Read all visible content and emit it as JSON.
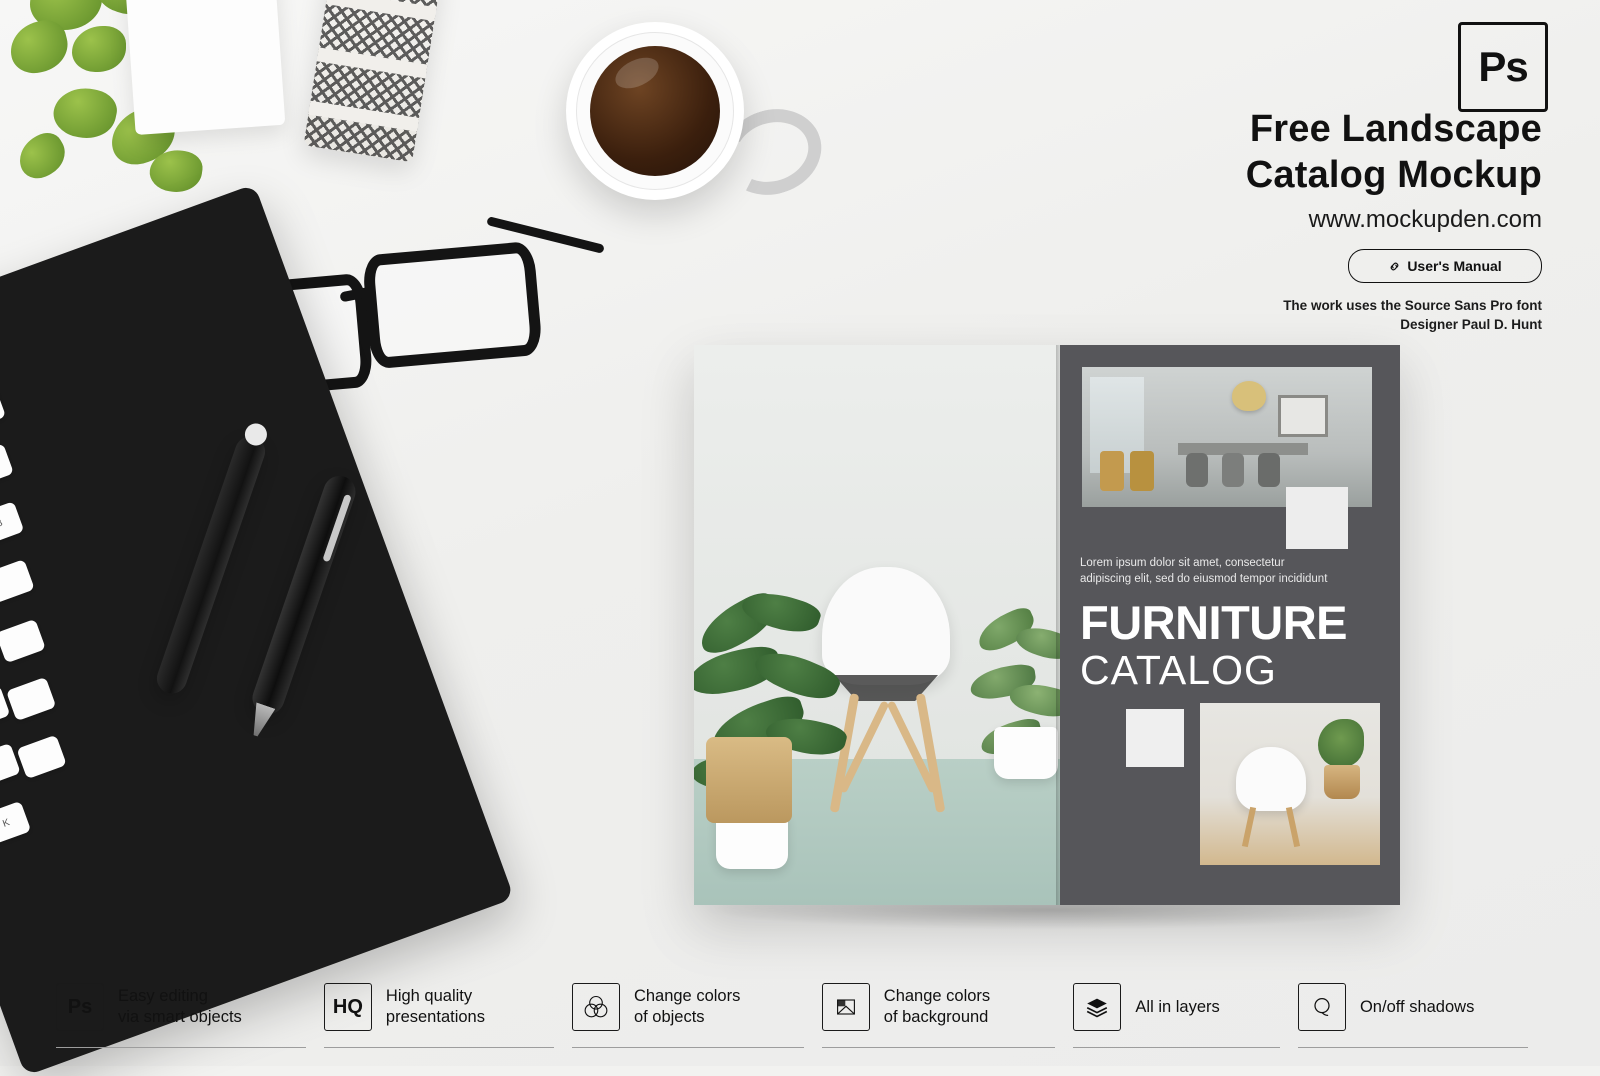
{
  "branding": {
    "ps_badge": "Ps",
    "title_line1": "Free Landscape",
    "title_line2": "Catalog Mockup",
    "url": "www.mockupden.com",
    "manual_button": "User's Manual",
    "font_note_line1": "The work uses the Source Sans Pro font",
    "font_note_line2": "Designer Paul D. Hunt"
  },
  "catalog": {
    "lorem_line1": "Lorem ipsum dolor sit amet, consectetur",
    "lorem_line2": "adipiscing elit, sed do eiusmod tempor incididunt",
    "title": "FURNITURE",
    "subtitle": "CATALOG"
  },
  "features": [
    {
      "icon": "photoshop-icon",
      "icon_text": "Ps",
      "line1": "Easy editing",
      "line2": "via smart objects"
    },
    {
      "icon": "hq-icon",
      "icon_text": "HQ",
      "line1": "High quality",
      "line2": "presentations"
    },
    {
      "icon": "color-circles-icon",
      "icon_text": "",
      "line1": "Change colors",
      "line2": "of objects"
    },
    {
      "icon": "background-icon",
      "icon_text": "",
      "line1": "Change colors",
      "line2": "of background"
    },
    {
      "icon": "layers-icon",
      "icon_text": "",
      "line1": "All in layers",
      "line2": ""
    },
    {
      "icon": "shadow-icon",
      "icon_text": "",
      "line1": "On/off shadows",
      "line2": ""
    }
  ],
  "colors": {
    "background": "#f2f2f0",
    "cover_panel": "#56565a",
    "text_dark": "#111111",
    "rule": "#9d9d9d"
  }
}
